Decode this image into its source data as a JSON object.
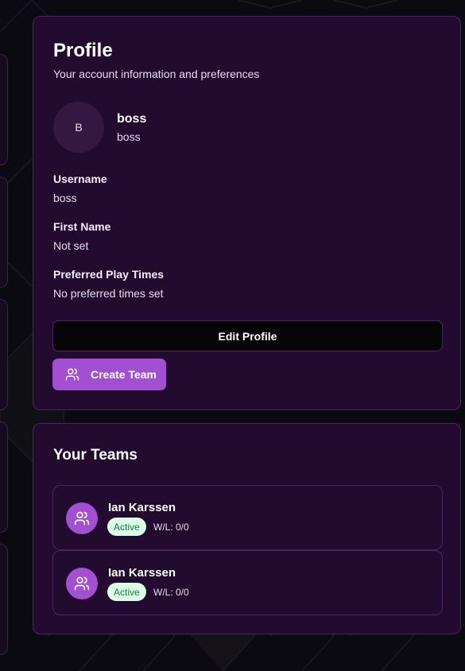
{
  "profile": {
    "title": "Profile",
    "subtitle": "Your account information and preferences",
    "avatar_initial": "B",
    "display_name": "boss",
    "display_username": "boss",
    "fields": [
      {
        "label": "Username",
        "value": "boss"
      },
      {
        "label": "First Name",
        "value": "Not set"
      },
      {
        "label": "Preferred Play Times",
        "value": "No preferred times set"
      }
    ],
    "edit_button": "Edit Profile",
    "create_team_button": "Create Team"
  },
  "teams": {
    "title": "Your Teams",
    "items": [
      {
        "name": "Ian Karssen",
        "status": "Active",
        "record": "W/L: 0/0"
      },
      {
        "name": "Ian Karssen",
        "status": "Active",
        "record": "W/L: 0/0"
      }
    ]
  },
  "colors": {
    "accent": "#a24fd1",
    "card_bg": "#230b2f",
    "border": "#4a2660",
    "active_badge_bg": "#dcfce7",
    "active_badge_text": "#15803d"
  },
  "icons": {
    "create_team": "users-icon",
    "team_avatar": "users-icon"
  }
}
